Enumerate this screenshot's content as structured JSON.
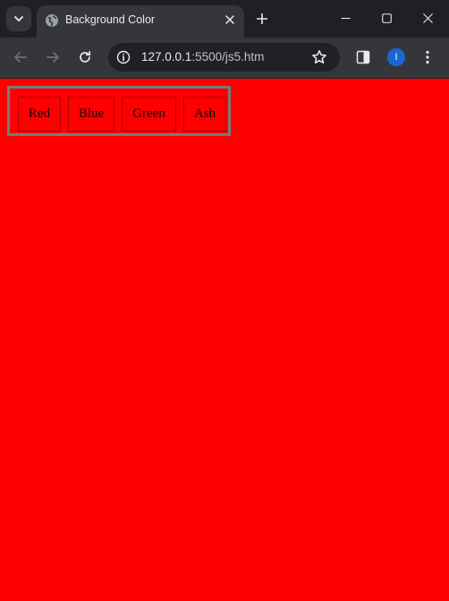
{
  "browser": {
    "tab": {
      "title": "Background Color"
    },
    "address_bar": {
      "host": "127.0.0.1",
      "path": ":5500/js5.htm"
    },
    "profile_initial": "I",
    "colors": {
      "tabstrip_bg": "#1f2023",
      "toolbar_bg": "#35363a",
      "omnibox_bg": "#202124",
      "profile_accent": "#1967d2"
    }
  },
  "page": {
    "background_color": "#ff0000",
    "buttons": [
      {
        "label": "Red"
      },
      {
        "label": "Blue"
      },
      {
        "label": "Green"
      },
      {
        "label": "Ash"
      }
    ]
  },
  "icons": [
    "tab-search-icon",
    "globe-icon",
    "close-icon",
    "plus-icon",
    "minimize-icon",
    "maximize-icon",
    "window-close-icon",
    "back-arrow-icon",
    "forward-arrow-icon",
    "reload-icon",
    "site-info-icon",
    "star-icon",
    "side-panel-icon",
    "more-vert-icon"
  ]
}
